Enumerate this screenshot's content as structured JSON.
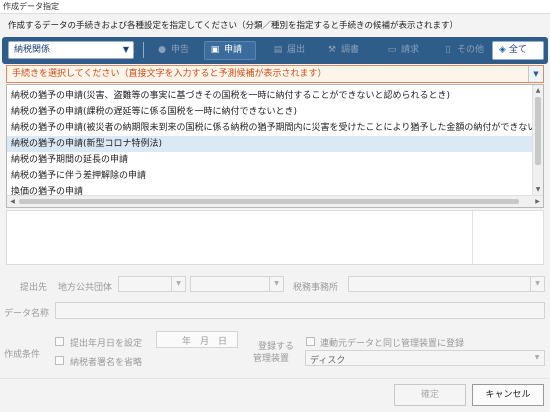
{
  "window": {
    "title": "作成データ指定"
  },
  "instruction": "作成するデータの手続きおよび各種設定を指定してください（分類／種別を指定すると手続きの候補が表示されます）",
  "toolbar": {
    "category_value": "納税関係",
    "buttons": [
      {
        "label": "申告",
        "icon": "chat-bubble-icon",
        "enabled": false
      },
      {
        "label": "申請",
        "icon": "printer-icon",
        "enabled": true
      },
      {
        "label": "届出",
        "icon": "document-stack-icon",
        "enabled": false
      },
      {
        "label": "調書",
        "icon": "gavel-icon",
        "enabled": false
      },
      {
        "label": "請求",
        "icon": "card-icon",
        "enabled": false
      },
      {
        "label": "その他",
        "icon": "document-icon",
        "enabled": false
      }
    ],
    "all_label": "全て"
  },
  "procedure": {
    "placeholder": "手続きを選択してください（直接文字を入力すると予測候補が表示されます）",
    "options": [
      "納税の猶予の申請(災害、盗難等の事実に基づきその国税を一時に納付することができないと認められるとき)",
      "納税の猶予の申請(課税の遅延等に係る国税を一時に納付できないとき)",
      "納税の猶予の申請(被災者の納期限未到来の国税に係る納税の猶予期間内に災害を受けたことにより猶予した金額の納付ができないとき)",
      "納税の猶予の申請(新型コロナ特例法)",
      "納税の猶予期間の延長の申請",
      "納税の猶予に伴う差押解除の申請",
      "換価の猶予の申請"
    ],
    "selected_index": 3
  },
  "form": {
    "submit_to_label": "提出先",
    "local_gov_label": "地方公共団体",
    "tax_office_label": "税務事務所",
    "data_name_label": "データ名称",
    "conditions_label": "作成条件",
    "set_date_label": "提出年月日を設定",
    "date_placeholder": "年　月　日",
    "omit_signer_label": "納税者署名を省略",
    "register_device_label_1": "登録する",
    "register_device_label_2": "管理装置",
    "same_device_label": "連動元データと同じ管理装置に登録",
    "device_value": "ディスク"
  },
  "buttons": {
    "ok": "確定",
    "cancel": "キャンセル"
  },
  "colors": {
    "toolbar_bg": "#2f5d8a",
    "accent_orange": "#c9501a",
    "selection_bg": "#dbe8f6"
  }
}
